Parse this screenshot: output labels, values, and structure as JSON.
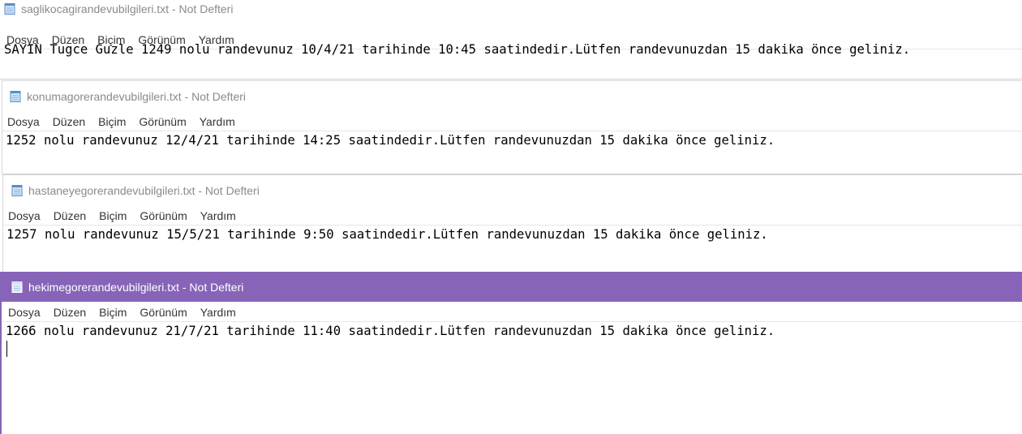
{
  "menu": [
    "Dosya",
    "Düzen",
    "Biçim",
    "Görünüm",
    "Yardım"
  ],
  "windows": [
    {
      "title": "saglikocagirandevubilgileri.txt - Not Defteri",
      "content": "SAYIN Tugce Guzle 1249 nolu randevunuz 10/4/21 tarihinde 10:45 saatindedir.Lütfen randevunuzdan 15 dakika önce geliniz.",
      "active": false
    },
    {
      "title": "konumagorerandevubilgileri.txt - Not Defteri",
      "content": "1252 nolu randevunuz 12/4/21 tarihinde 14:25 saatindedir.Lütfen randevunuzdan 15 dakika önce geliniz.",
      "active": false
    },
    {
      "title": "hastaneyegorerandevubilgileri.txt - Not Defteri",
      "content": "1257 nolu randevunuz 15/5/21 tarihinde 9:50 saatindedir.Lütfen randevunuzdan 15 dakika önce geliniz.",
      "active": false
    },
    {
      "title": "hekimegorerandevubilgileri.txt - Not Defteri",
      "content": "1266 nolu randevunuz 21/7/21 tarihinde 11:40 saatindedir.Lütfen randevunuzdan 15 dakika önce geliniz.",
      "active": true
    }
  ],
  "colors": {
    "active_titlebar": "#8764b8",
    "inactive_title_text": "#8a8a8a"
  },
  "icons": {
    "window_icon": "notepad-icon"
  }
}
